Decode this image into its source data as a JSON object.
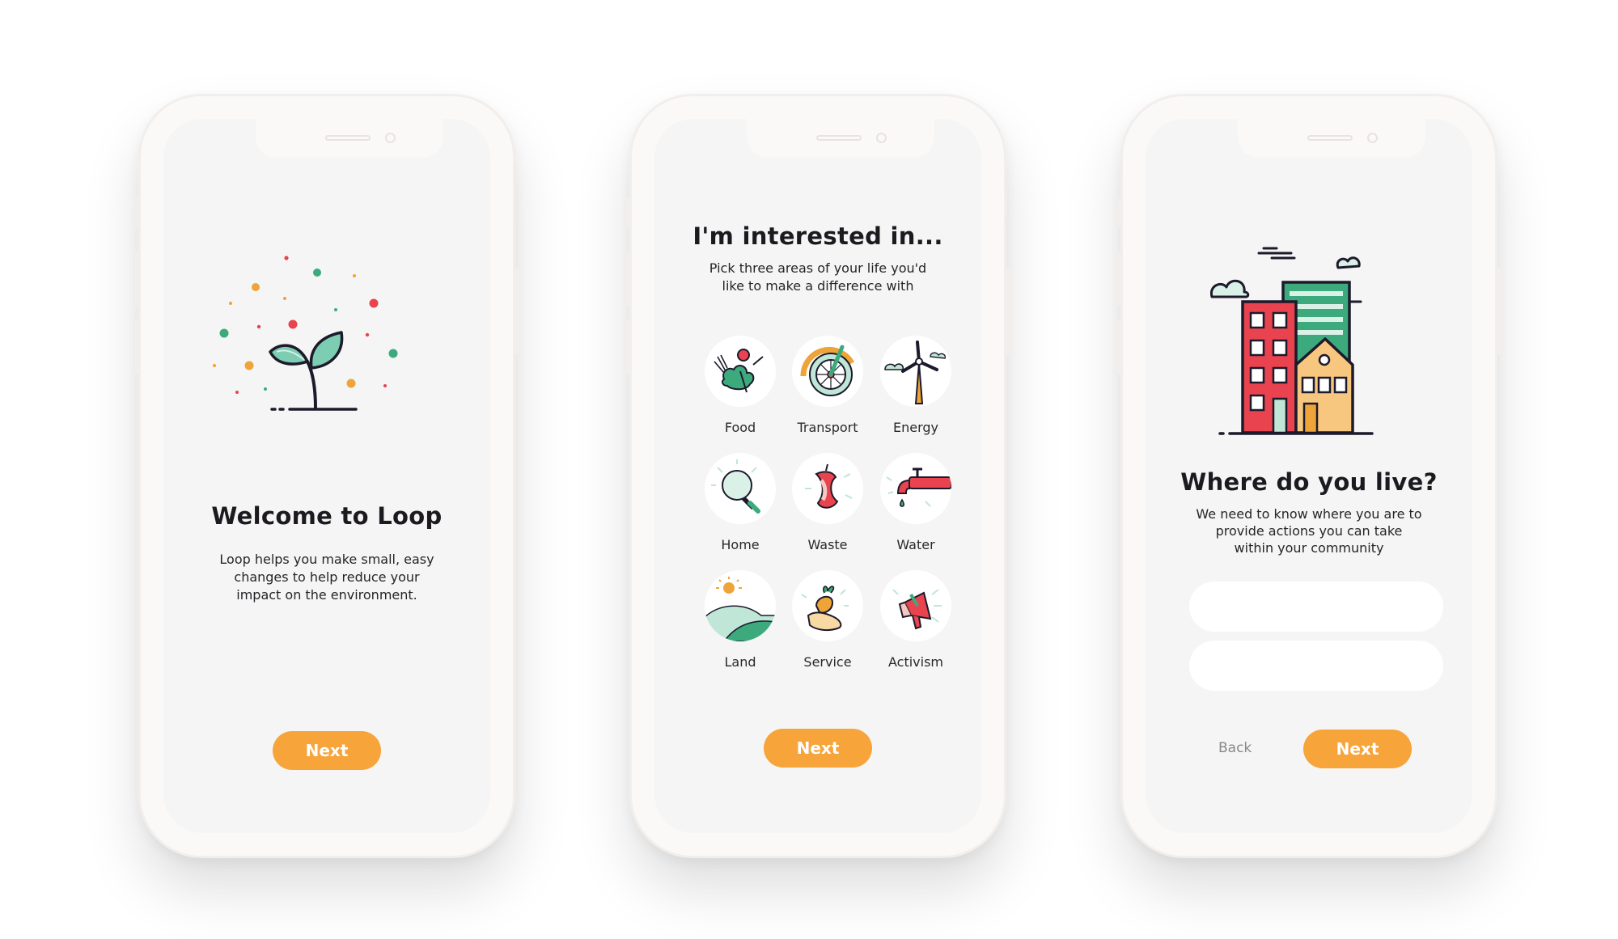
{
  "screens": [
    {
      "title": "Welcome to Loop",
      "body": [
        "Loop helps you make small, easy",
        "changes to help reduce your",
        "impact on the environment."
      ],
      "next_label": "Next"
    },
    {
      "title": "I'm interested in...",
      "subtitle": [
        "Pick three areas of your life you'd",
        "like to make a difference with"
      ],
      "categories": [
        "Food",
        "Transport",
        "Energy",
        "Home",
        "Waste",
        "Water",
        "Land",
        "Service",
        "Activism"
      ],
      "next_label": "Next"
    },
    {
      "title": "Where do you live?",
      "body": [
        "We need to know where you are to",
        "provide actions you can take",
        "within your community"
      ],
      "back_label": "Back",
      "next_label": "Next"
    }
  ],
  "colors": {
    "accent": "#f7a43a",
    "green": "#3daa7d",
    "red": "#e8434f",
    "dark": "#1c1a2b"
  }
}
